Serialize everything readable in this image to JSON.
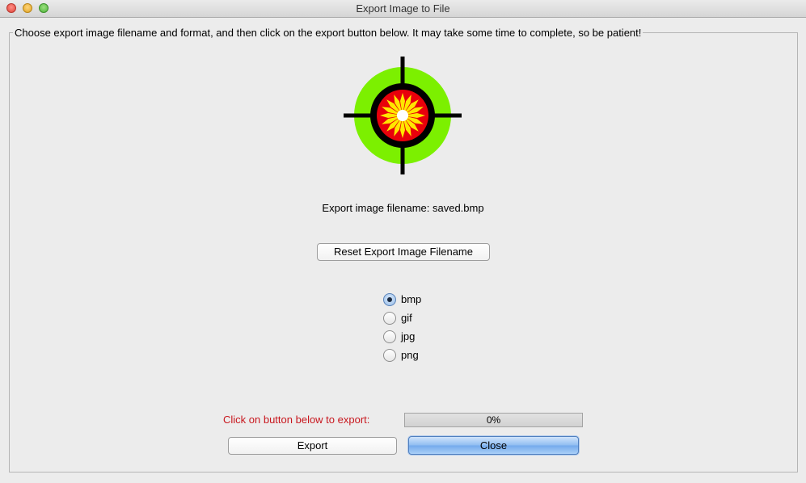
{
  "window": {
    "title": "Export Image to File"
  },
  "panel": {
    "legend": "Choose export image filename and format, and then click on the export button below.  It may take some time to complete, so be patient!"
  },
  "logo": {
    "icon": "target-crosshair-sunflower-icon",
    "colors": {
      "outer_ring": "#7cf000",
      "black_ring": "#000000",
      "inner_disc": "#e8000b",
      "petals": "#ffe600",
      "center": "#ffffff"
    }
  },
  "filename_label": "Export image filename: saved.bmp",
  "reset_button_label": "Reset Export Image Filename",
  "formats": [
    {
      "label": "bmp",
      "selected": true
    },
    {
      "label": "gif",
      "selected": false
    },
    {
      "label": "jpg",
      "selected": false
    },
    {
      "label": "png",
      "selected": false
    }
  ],
  "status": {
    "label": "Click on button below to export:",
    "color": "#c8161d"
  },
  "progress": {
    "value_percent": 0,
    "text": "0%"
  },
  "buttons": {
    "export_label": "Export",
    "close_label": "Close"
  }
}
